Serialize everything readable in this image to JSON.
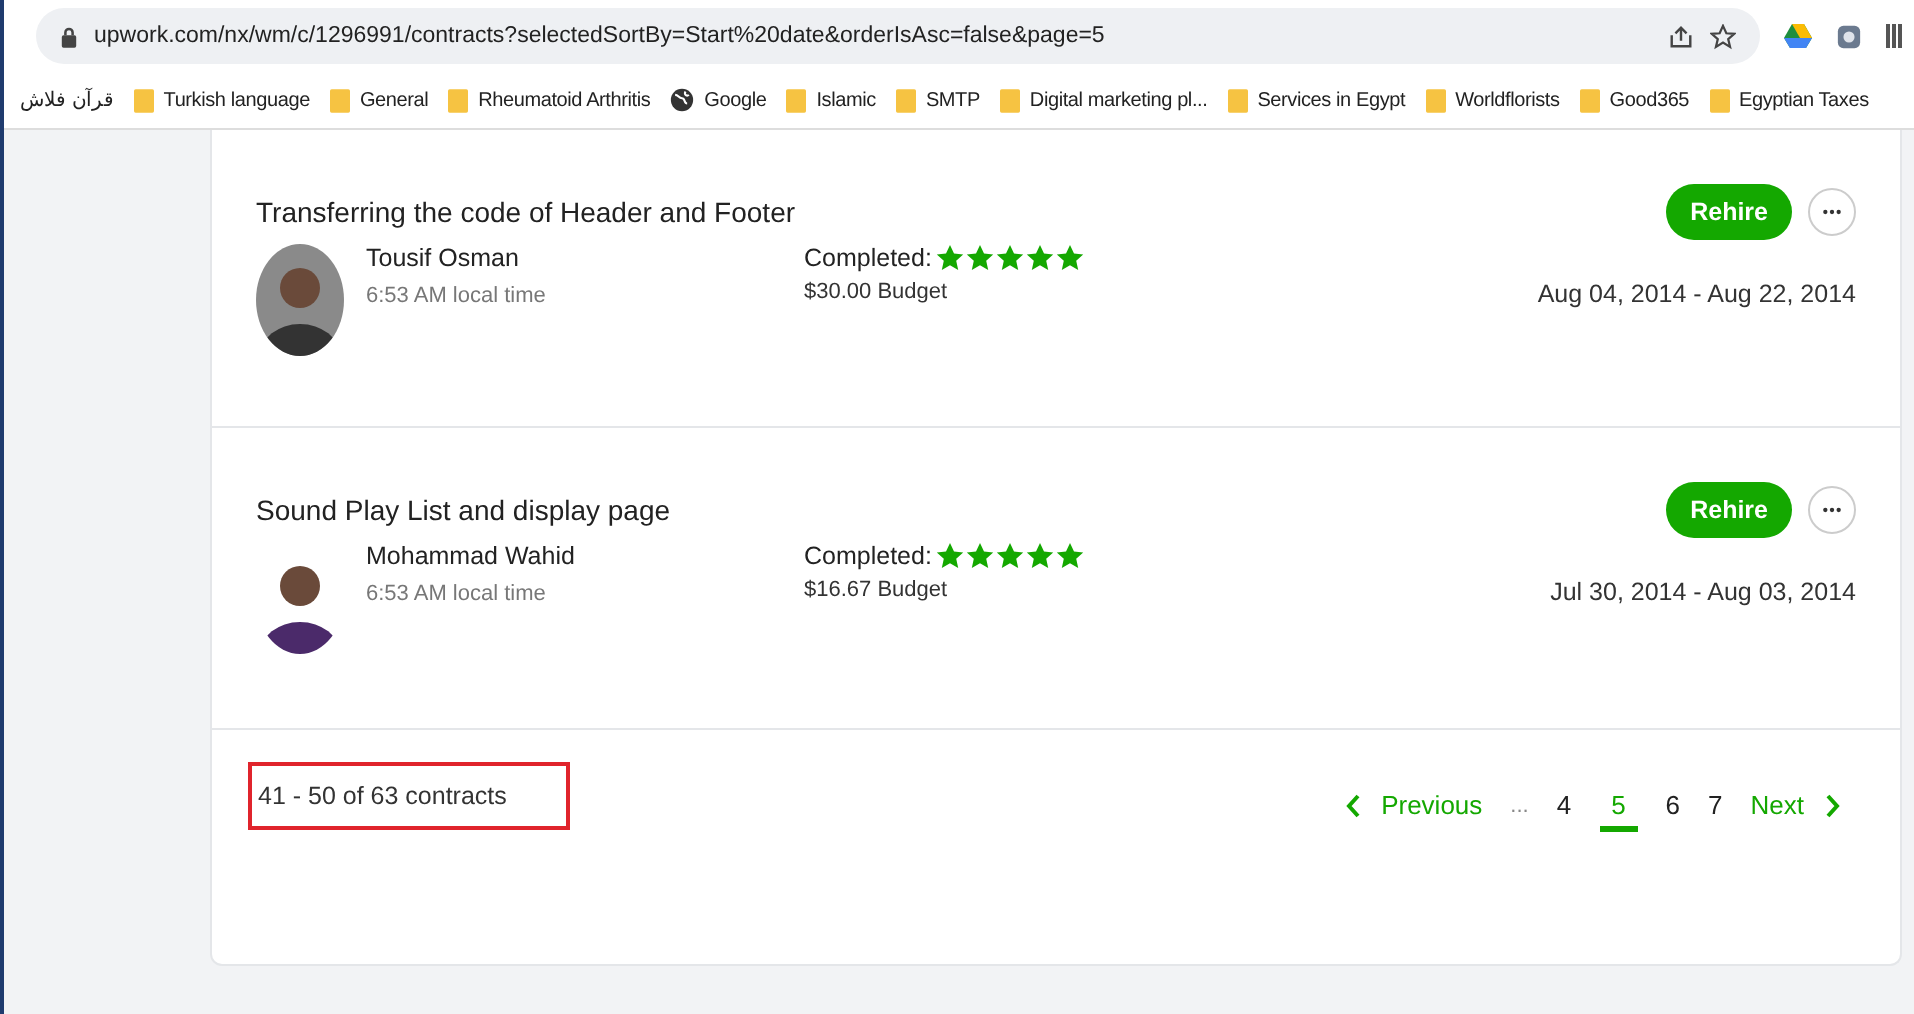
{
  "browser": {
    "url": "upwork.com/nx/wm/c/1296991/contracts?selectedSortBy=Start%20date&orderIsAsc=false&page=5",
    "bookmarks": [
      {
        "label": "قرآن فلاش",
        "kind": "plain"
      },
      {
        "label": "Turkish language",
        "kind": "folder"
      },
      {
        "label": "General",
        "kind": "folder"
      },
      {
        "label": "Rheumatoid Arthritis",
        "kind": "folder"
      },
      {
        "label": "Google",
        "kind": "globe"
      },
      {
        "label": "Islamic",
        "kind": "folder"
      },
      {
        "label": "SMTP",
        "kind": "folder"
      },
      {
        "label": "Digital marketing pl...",
        "kind": "folder"
      },
      {
        "label": "Services in Egypt",
        "kind": "folder"
      },
      {
        "label": "Worldflorists",
        "kind": "folder"
      },
      {
        "label": "Good365",
        "kind": "folder"
      },
      {
        "label": "Egyptian Taxes",
        "kind": "folder"
      }
    ]
  },
  "contracts": [
    {
      "title": "Transferring the code of Header and Footer",
      "freelancer": "Tousif Osman",
      "local_time": "6:53 AM local time",
      "status": "Completed:",
      "stars": 5,
      "budget": "$30.00 Budget",
      "button": "Rehire",
      "dates": "Aug 04, 2014 - Aug 22, 2014"
    },
    {
      "title": "Sound Play List and display page",
      "freelancer": "Mohammad Wahid",
      "local_time": "6:53 AM local time",
      "status": "Completed:",
      "stars": 5,
      "budget": "$16.67 Budget",
      "button": "Rehire",
      "dates": "Jul 30, 2014 - Aug 03, 2014"
    }
  ],
  "footer": {
    "count": "41 - 50 of 63 contracts",
    "previous": "Previous",
    "ellipsis": "...",
    "next": "Next",
    "pages": [
      {
        "label": "4",
        "selected": false
      },
      {
        "label": "5",
        "selected": true
      },
      {
        "label": "6",
        "selected": false
      },
      {
        "label": "7",
        "selected": false
      }
    ]
  }
}
